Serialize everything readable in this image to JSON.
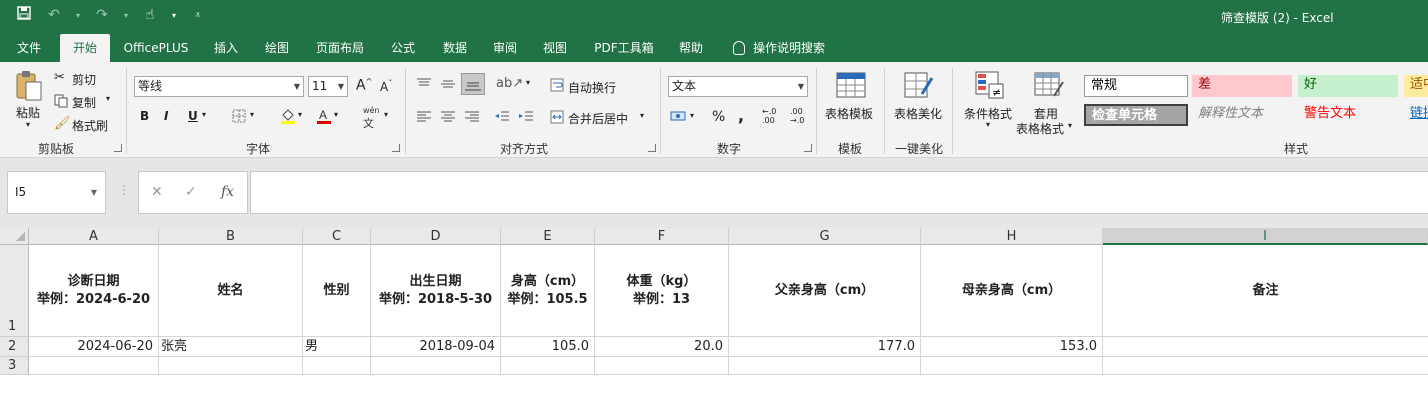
{
  "window": {
    "title": "筛查模版 (2)  -  Excel"
  },
  "tabs": [
    {
      "label": "文件"
    },
    {
      "label": "开始"
    },
    {
      "label": "OfficePLUS"
    },
    {
      "label": "插入"
    },
    {
      "label": "绘图"
    },
    {
      "label": "页面布局"
    },
    {
      "label": "公式"
    },
    {
      "label": "数据"
    },
    {
      "label": "审阅"
    },
    {
      "label": "视图"
    },
    {
      "label": "PDF工具箱"
    },
    {
      "label": "帮助"
    }
  ],
  "tell_me": "操作说明搜索",
  "ribbon": {
    "clipboard": {
      "paste": "粘贴",
      "cut": "剪切",
      "copy": "复制",
      "format_painter": "格式刷",
      "label": "剪贴板"
    },
    "font": {
      "font_name": "等线",
      "font_size": "11",
      "label": "字体",
      "bold": "B",
      "italic": "I",
      "underline": "U",
      "grow": "A",
      "shrink": "A",
      "phonetic": "wén"
    },
    "alignment": {
      "wrap": "自动换行",
      "merge": "合并后居中",
      "label": "对齐方式"
    },
    "number": {
      "format": "文本",
      "percent": "%",
      "comma": ",",
      "inc_decimal": "←.0 .00",
      "dec_decimal": ".00 →.0",
      "label": "数字"
    },
    "template": {
      "button": "表格模板",
      "label": "模板"
    },
    "beautify": {
      "button": "表格美化",
      "label": "一键美化"
    },
    "styles": {
      "conditional": "条件格式",
      "table_format_1": "套用",
      "table_format_2": "表格格式",
      "label": "样式",
      "cells": [
        {
          "text": "常规"
        },
        {
          "text": "差"
        },
        {
          "text": "好"
        },
        {
          "text": "适中"
        },
        {
          "text": "检查单元格"
        },
        {
          "text": "解释性文本"
        },
        {
          "text": "警告文本"
        },
        {
          "text": "链接"
        }
      ]
    }
  },
  "formula_bar": {
    "name_box": "I5",
    "formula": ""
  },
  "columns": [
    "A",
    "B",
    "C",
    "D",
    "E",
    "F",
    "G",
    "H",
    "I"
  ],
  "rows": [
    "1",
    "2",
    "3"
  ],
  "header_row": [
    {
      "line1": "诊断日期",
      "line2": "举例：2024-6-20"
    },
    {
      "line1": "姓名",
      "line2": ""
    },
    {
      "line1": "性别",
      "line2": ""
    },
    {
      "line1": "出生日期",
      "line2": "举例：2018-5-30"
    },
    {
      "line1": "身高（cm）",
      "line2": "举例：105.5"
    },
    {
      "line1": "体重（kg）",
      "line2": "举例：13"
    },
    {
      "line1": "父亲身高（cm）",
      "line2": ""
    },
    {
      "line1": "母亲身高（cm）",
      "line2": ""
    },
    {
      "line1": "备注",
      "line2": ""
    }
  ],
  "data_row": [
    "2024-06-20",
    "张亮",
    "男",
    "2018-09-04",
    "105.0",
    "20.0",
    "177.0",
    "153.0",
    ""
  ],
  "accent_color": "#217346"
}
